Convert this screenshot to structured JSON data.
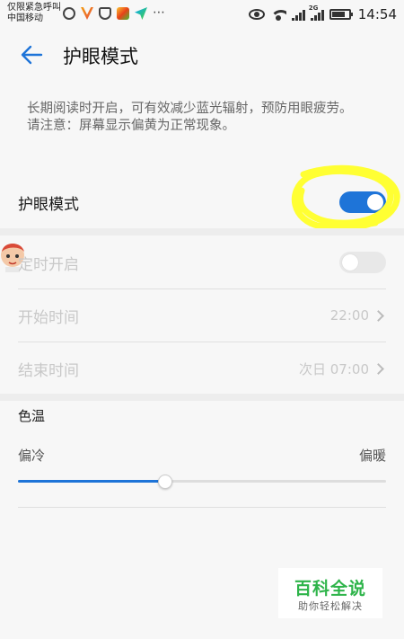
{
  "status_bar": {
    "carrier_line1": "仅限紧急呼叫",
    "carrier_line2": "中国移动",
    "network_tag": "2G",
    "time": "14:54"
  },
  "header": {
    "title": "护眼模式",
    "back_icon": "back-arrow-icon"
  },
  "description": {
    "line1": "长期阅读时开启，可有效减少蓝光辐射，预防用眼疲劳。",
    "line2": "请注意：屏幕显示偏黄为正常现象。"
  },
  "eye_mode": {
    "label": "护眼模式",
    "enabled": true
  },
  "schedule": {
    "label": "定时开启",
    "enabled": false,
    "start_label": "开始时间",
    "start_value": "22:00",
    "end_label": "结束时间",
    "end_value": "次日 07:00"
  },
  "color_temp": {
    "section_title": "色温",
    "min_label": "偏冷",
    "max_label": "偏暖",
    "level": 0.4
  },
  "watermark": {
    "main": "百科全说",
    "sub": "助你轻松解决"
  },
  "colors": {
    "accent": "#1e74d8",
    "highlight": "#ffff33",
    "watermark_green": "#2eb44a"
  }
}
